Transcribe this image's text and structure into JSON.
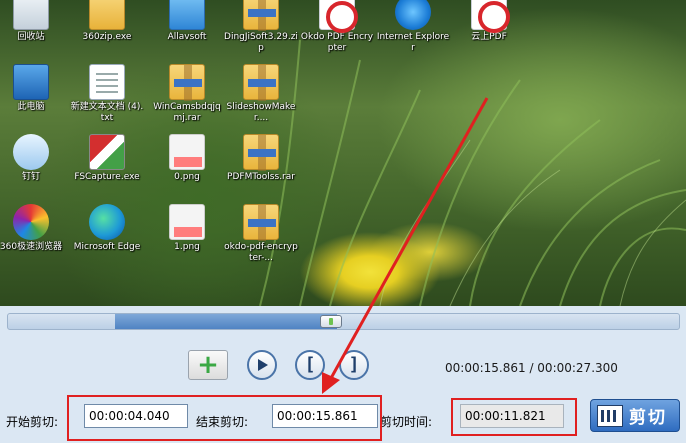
{
  "desktop_icons": [
    {
      "label": "回收站",
      "icon": "recycle-bin-icon",
      "style": "recycle"
    },
    {
      "label": "360zip.exe",
      "icon": "archive-icon",
      "style": "zip360"
    },
    {
      "label": "Allavsoft",
      "icon": "shortcut-icon",
      "style": "blue"
    },
    {
      "label": "DingJiSoft3.29.zip",
      "icon": "archive-icon",
      "style": "folder"
    },
    {
      "label": "Okdo PDF Encrypter",
      "icon": "pdf-encrypter-icon",
      "style": "pdf-red"
    },
    {
      "label": "Internet Explorer",
      "icon": "internet-explorer-icon",
      "style": "ie"
    },
    {
      "label": "云上PDF",
      "icon": "pdf-icon",
      "style": "pdf-red"
    },
    {
      "label": "此电脑",
      "icon": "computer-icon",
      "style": "pc"
    },
    {
      "label": "新建文本文档 (4).txt",
      "icon": "text-file-icon",
      "style": "doc"
    },
    {
      "label": "WinCamsbdqjqmj.rar",
      "icon": "archive-icon",
      "style": "folder"
    },
    {
      "label": "SlideshowMaker....",
      "icon": "archive-icon",
      "style": "folder"
    },
    {
      "label": "钉钉",
      "icon": "dingtalk-icon",
      "style": "bird"
    },
    {
      "label": "FSCapture.exe",
      "icon": "fscapture-icon",
      "style": "fscap"
    },
    {
      "label": "0.png",
      "icon": "image-file-icon",
      "style": "png"
    },
    {
      "label": "PDFMToolss.rar",
      "icon": "archive-icon",
      "style": "folder"
    },
    {
      "label": "360极速浏览器",
      "icon": "browser-360-icon",
      "style": "color360"
    },
    {
      "label": "Microsoft Edge",
      "icon": "edge-icon",
      "style": "edge"
    },
    {
      "label": "1.png",
      "icon": "image-file-icon",
      "style": "png"
    },
    {
      "label": "okdo-pdf-encrypter-...",
      "icon": "archive-icon",
      "style": "folder"
    }
  ],
  "player": {
    "progress": 0.427,
    "add_label": "+",
    "time_current": "00:00:15.861",
    "time_separator": " / ",
    "time_total": "00:00:27.300"
  },
  "trim": {
    "start_label": "开始剪切:",
    "start_value": "00:00:04.040",
    "end_label": "结束剪切:",
    "end_value": "00:00:15.861",
    "duration_label": "剪切时间:",
    "duration_value": "00:00:11.821",
    "cut_button_label": "剪切"
  },
  "colors": {
    "annotation": "#e02020",
    "seek_fill": "#4f83c3",
    "cut_button": "#2f6cc0"
  }
}
